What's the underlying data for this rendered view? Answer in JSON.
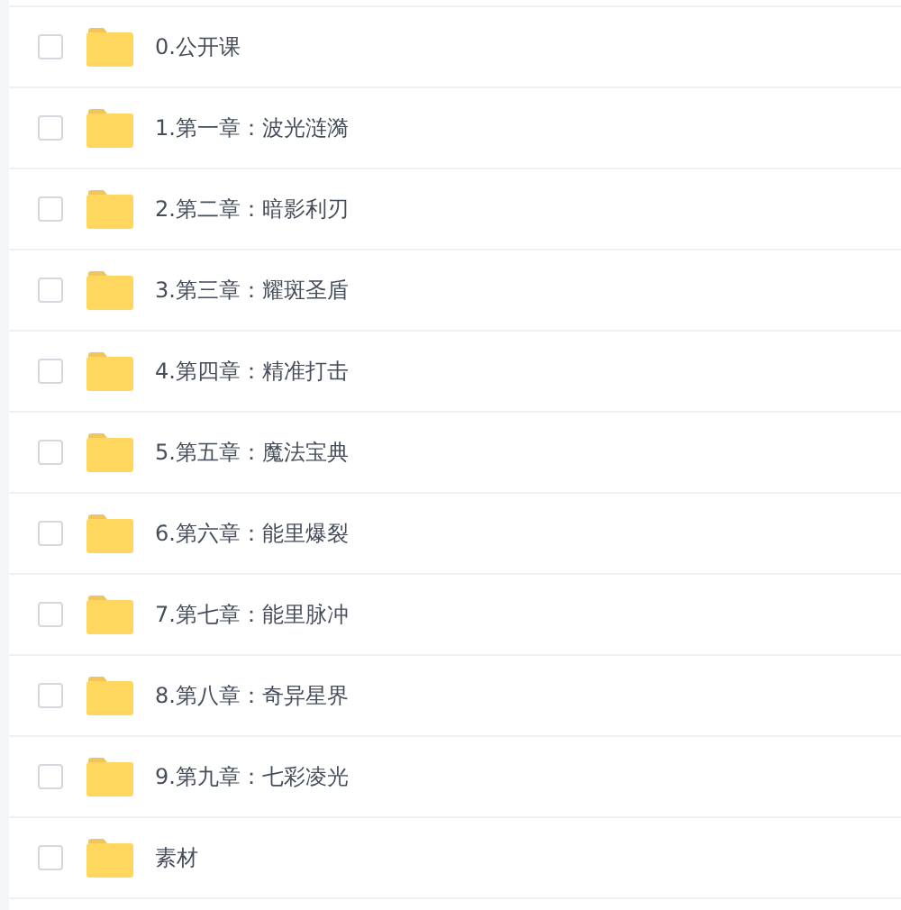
{
  "files": [
    {
      "name": "0.公开课",
      "checked": false
    },
    {
      "name": "1.第一章：波光涟漪",
      "checked": false
    },
    {
      "name": "2.第二章：暗影利刃",
      "checked": false
    },
    {
      "name": "3.第三章：耀斑圣盾",
      "checked": false
    },
    {
      "name": "4.第四章：精准打击",
      "checked": false
    },
    {
      "name": "5.第五章：魔法宝典",
      "checked": false
    },
    {
      "name": "6.第六章：能里爆裂",
      "checked": false
    },
    {
      "name": "7.第七章：能里脉冲",
      "checked": false
    },
    {
      "name": "8.第八章：奇异星界",
      "checked": false
    },
    {
      "name": "9.第九章：七彩凌光",
      "checked": false
    },
    {
      "name": "素材",
      "checked": false
    }
  ]
}
